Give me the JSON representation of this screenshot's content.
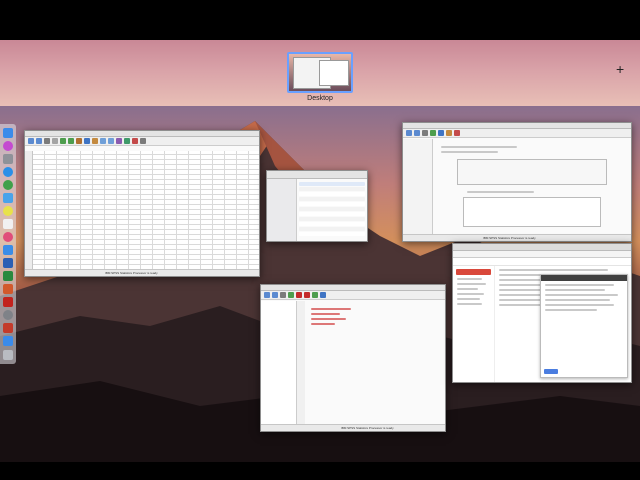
{
  "mission_control": {
    "desktop_label": "Desktop",
    "add_space_label": "+"
  },
  "windows": {
    "spss_data_editor": {
      "status_text": "IBM SPSS Statistics Processor is ready"
    },
    "spss_output": {
      "status_text": "IBM SPSS Statistics Processor is ready"
    },
    "spss_syntax": {
      "status_text": "IBM SPSS Statistics Processor is ready"
    }
  },
  "dock": {
    "icons": [
      "finder-icon",
      "siri-icon",
      "launchpad-icon",
      "safari-icon",
      "chrome-icon",
      "mail-icon",
      "photos-icon",
      "calendar-icon",
      "itunes-icon",
      "appstore-icon",
      "word-icon",
      "excel-icon",
      "powerpoint-icon",
      "acrobat-icon",
      "preferences-icon",
      "spss-icon",
      "finder2-icon",
      "trash-icon"
    ],
    "colors": [
      "#3b8bea",
      "#c44ad0",
      "#8f9299",
      "#2a8fe8",
      "#3fa04a",
      "#4aa3ea",
      "#e8e24a",
      "#f1f1f1",
      "#e04e7a",
      "#3a8de8",
      "#2b5fb4",
      "#2a8a3f",
      "#d2592c",
      "#c2231e",
      "#7f8288",
      "#c43b2b",
      "#3b8bea",
      "#b9bcc2"
    ]
  }
}
